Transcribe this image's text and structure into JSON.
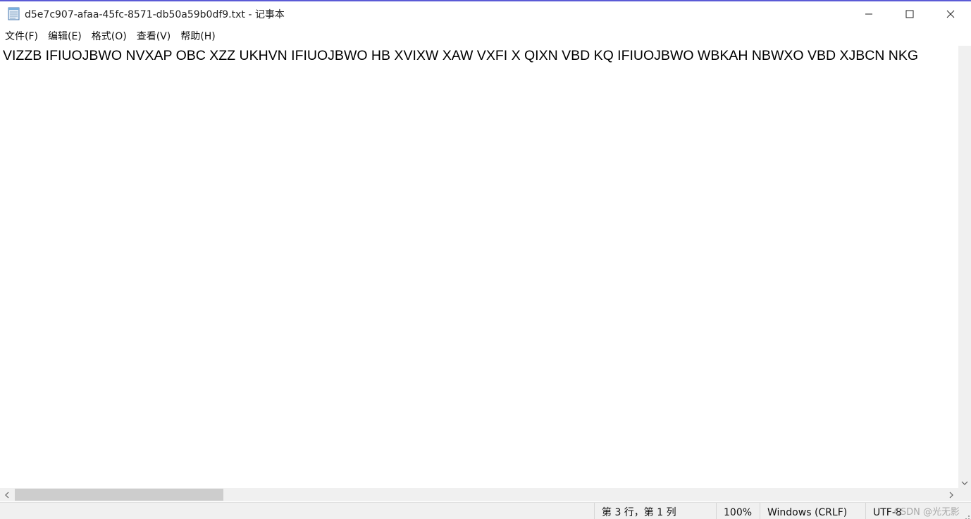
{
  "window": {
    "title": "d5e7c907-afaa-45fc-8571-db50a59b0df9.txt - 记事本"
  },
  "menu": [
    {
      "label": "文件(F)"
    },
    {
      "label": "编辑(E)"
    },
    {
      "label": "格式(O)"
    },
    {
      "label": "查看(V)"
    },
    {
      "label": "帮助(H)"
    }
  ],
  "editor": {
    "content": "VIZZB IFIUOJBWO NVXAP OBC XZZ UKHVN IFIUOJBWO HB XVIXW XAW VXFI X QIXN VBD KQ IFIUOJBWO WBKAH NBWXO VBD XJBCN NKG"
  },
  "scrollbar": {
    "horizontal_thumb_fraction": 0.22
  },
  "status": {
    "position": "第 3 行，第 1 列",
    "zoom": "100%",
    "line_ending": "Windows (CRLF)",
    "encoding": "UTF-8"
  },
  "watermark": "CSDN @光无影",
  "icons": {
    "app": "notepad-icon",
    "minimize": "minimize-icon",
    "maximize": "maximize-icon",
    "close": "close-icon"
  }
}
